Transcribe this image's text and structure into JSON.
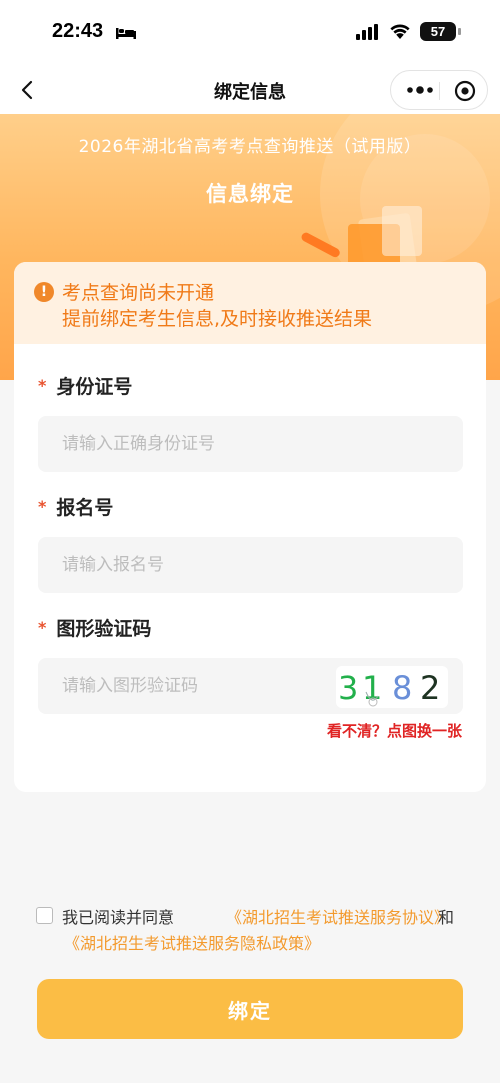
{
  "status_bar": {
    "time": "22:43",
    "battery": "57"
  },
  "nav": {
    "title": "绑定信息"
  },
  "hero": {
    "title": "2026年湖北省高考考点查询推送（试用版）",
    "subtitle": "信息绑定"
  },
  "notice": {
    "line1": "考点查询尚未开通",
    "line2": "提前绑定考生信息,及时接收推送结果"
  },
  "form": {
    "required_mark": "*",
    "id_card": {
      "label": "身份证号",
      "placeholder": "请输入正确身份证号",
      "value": ""
    },
    "reg_no": {
      "label": "报名号",
      "placeholder": "请输入报名号",
      "value": ""
    },
    "captcha": {
      "label": "图形验证码",
      "placeholder": "请输入图形验证码",
      "value": "",
      "image_chars": [
        "3",
        "1",
        "8",
        "2"
      ],
      "image_colors": [
        "#22b04b",
        "#22b04b",
        "#6a8fd8",
        "#1e3322"
      ],
      "refresh_hint": "看不清？点图换一张"
    }
  },
  "agreement": {
    "checked": false,
    "prefix": "我已阅读并同意",
    "link1": "《湖北招生考试推送服务协议》",
    "and": "和",
    "link2": "《湖北招生考试推送服务隐私政策》"
  },
  "submit": {
    "label": "绑定"
  },
  "colors": {
    "accent": "#fbbd45",
    "notice_text": "#f07a18",
    "link": "#f39a2d",
    "error": "#e02424"
  }
}
